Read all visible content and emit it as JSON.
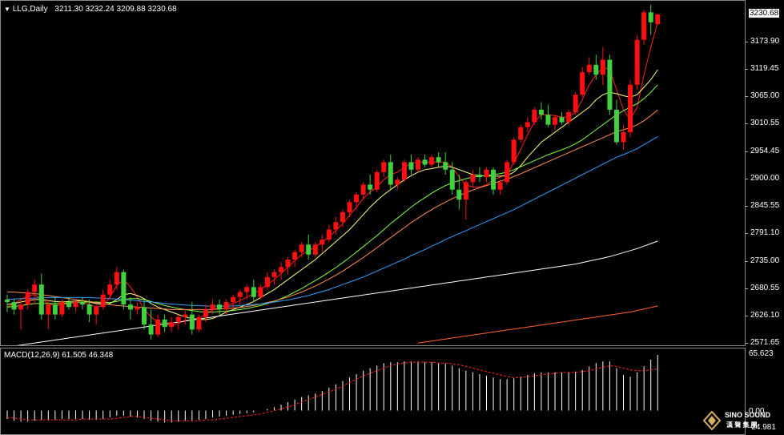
{
  "header": {
    "symbol_label": "LLG,Daily",
    "ohlc": "3211.30 3232.24 3209.88 3230.68",
    "menu_icon": "triangle-down-icon"
  },
  "price_axis": {
    "current": "3230.68",
    "ticks": [
      "3173.90",
      "3119.45",
      "3065.00",
      "3010.55",
      "2954.45",
      "2900.00",
      "2845.55",
      "2791.10",
      "2735.00",
      "2680.55",
      "2626.10",
      "2571.65"
    ]
  },
  "macd": {
    "label": "MACD(12,26,9) 61.505 46.348",
    "axis_top": "65.623",
    "axis_zero": "0.00",
    "axis_bottom": "-24.981"
  },
  "watermark": {
    "line1": "SINO SOUND",
    "line2": "漢 聲 集 團"
  },
  "colors": {
    "up": "#ff1010",
    "down": "#40d040",
    "ma5": "#ff2020",
    "ma10": "#ffff80",
    "ma20": "#80ff40",
    "ma30": "#ff9050",
    "ma60": "#30a0ff",
    "ma120": "#ffffff",
    "ma250": "#ff6030",
    "macd_bars": "#ffffff",
    "signal": "#ff2020"
  },
  "chart_data": {
    "type": "candlestick",
    "ylim": [
      2571.65,
      3250
    ],
    "candles": [
      [
        2660,
        2670,
        2635,
        2655
      ],
      [
        2655,
        2662,
        2630,
        2640
      ],
      [
        2640,
        2660,
        2600,
        2650
      ],
      [
        2650,
        2680,
        2640,
        2675
      ],
      [
        2675,
        2700,
        2650,
        2690
      ],
      [
        2690,
        2712,
        2620,
        2630
      ],
      [
        2630,
        2660,
        2600,
        2650
      ],
      [
        2650,
        2665,
        2620,
        2630
      ],
      [
        2630,
        2660,
        2625,
        2655
      ],
      [
        2655,
        2665,
        2640,
        2645
      ],
      [
        2645,
        2660,
        2635,
        2655
      ],
      [
        2655,
        2665,
        2640,
        2650
      ],
      [
        2650,
        2660,
        2615,
        2630
      ],
      [
        2630,
        2650,
        2610,
        2645
      ],
      [
        2645,
        2680,
        2640,
        2670
      ],
      [
        2670,
        2700,
        2660,
        2690
      ],
      [
        2690,
        2725,
        2680,
        2715
      ],
      [
        2715,
        2720,
        2640,
        2650
      ],
      [
        2650,
        2665,
        2620,
        2640
      ],
      [
        2640,
        2655,
        2630,
        2645
      ],
      [
        2645,
        2660,
        2600,
        2610
      ],
      [
        2610,
        2640,
        2580,
        2590
      ],
      [
        2590,
        2630,
        2585,
        2620
      ],
      [
        2620,
        2630,
        2595,
        2605
      ],
      [
        2605,
        2625,
        2595,
        2615
      ],
      [
        2615,
        2630,
        2600,
        2625
      ],
      [
        2625,
        2640,
        2610,
        2630
      ],
      [
        2630,
        2655,
        2590,
        2600
      ],
      [
        2600,
        2630,
        2595,
        2625
      ],
      [
        2625,
        2650,
        2615,
        2640
      ],
      [
        2640,
        2660,
        2630,
        2650
      ],
      [
        2650,
        2660,
        2630,
        2640
      ],
      [
        2640,
        2660,
        2630,
        2655
      ],
      [
        2655,
        2670,
        2640,
        2665
      ],
      [
        2665,
        2680,
        2650,
        2675
      ],
      [
        2675,
        2690,
        2660,
        2685
      ],
      [
        2685,
        2700,
        2655,
        2665
      ],
      [
        2665,
        2690,
        2660,
        2685
      ],
      [
        2685,
        2715,
        2680,
        2705
      ],
      [
        2705,
        2720,
        2690,
        2715
      ],
      [
        2715,
        2735,
        2700,
        2725
      ],
      [
        2725,
        2745,
        2710,
        2740
      ],
      [
        2740,
        2760,
        2725,
        2755
      ],
      [
        2755,
        2775,
        2745,
        2770
      ],
      [
        2770,
        2790,
        2740,
        2750
      ],
      [
        2750,
        2775,
        2745,
        2770
      ],
      [
        2770,
        2790,
        2755,
        2780
      ],
      [
        2780,
        2810,
        2775,
        2800
      ],
      [
        2800,
        2825,
        2790,
        2815
      ],
      [
        2815,
        2840,
        2805,
        2835
      ],
      [
        2835,
        2860,
        2825,
        2855
      ],
      [
        2855,
        2875,
        2840,
        2870
      ],
      [
        2870,
        2895,
        2860,
        2890
      ],
      [
        2890,
        2910,
        2870,
        2880
      ],
      [
        2880,
        2920,
        2875,
        2915
      ],
      [
        2915,
        2940,
        2905,
        2935
      ],
      [
        2935,
        2950,
        2880,
        2890
      ],
      [
        2890,
        2905,
        2880,
        2900
      ],
      [
        2900,
        2940,
        2895,
        2935
      ],
      [
        2935,
        2950,
        2910,
        2920
      ],
      [
        2920,
        2945,
        2915,
        2940
      ],
      [
        2940,
        2950,
        2925,
        2930
      ],
      [
        2930,
        2950,
        2925,
        2945
      ],
      [
        2945,
        2955,
        2925,
        2935
      ],
      [
        2935,
        2955,
        2910,
        2920
      ],
      [
        2920,
        2935,
        2870,
        2880
      ],
      [
        2880,
        2910,
        2840,
        2860
      ],
      [
        2860,
        2900,
        2820,
        2895
      ],
      [
        2895,
        2920,
        2885,
        2910
      ],
      [
        2910,
        2925,
        2895,
        2905
      ],
      [
        2905,
        2925,
        2895,
        2920
      ],
      [
        2920,
        2925,
        2870,
        2880
      ],
      [
        2880,
        2900,
        2870,
        2895
      ],
      [
        2895,
        2940,
        2890,
        2935
      ],
      [
        2935,
        2985,
        2930,
        2980
      ],
      [
        2980,
        3010,
        2975,
        3005
      ],
      [
        3005,
        3025,
        2995,
        3015
      ],
      [
        3015,
        3045,
        3010,
        3040
      ],
      [
        3040,
        3055,
        3020,
        3030
      ],
      [
        3030,
        3050,
        3005,
        3010
      ],
      [
        3010,
        3030,
        3000,
        3025
      ],
      [
        3025,
        3035,
        3010,
        3015
      ],
      [
        3015,
        3040,
        3010,
        3035
      ],
      [
        3035,
        3075,
        3030,
        3070
      ],
      [
        3070,
        3125,
        3065,
        3115
      ],
      [
        3115,
        3145,
        3110,
        3130
      ],
      [
        3130,
        3150,
        3100,
        3110
      ],
      [
        3110,
        3165,
        3090,
        3140
      ],
      [
        3140,
        3150,
        3030,
        3040
      ],
      [
        3040,
        3060,
        2970,
        2975
      ],
      [
        2975,
        3010,
        2960,
        2995
      ],
      [
        2995,
        3100,
        2985,
        3090
      ],
      [
        3090,
        3190,
        3080,
        3180
      ],
      [
        3180,
        3240,
        3170,
        3235
      ],
      [
        3235,
        3250,
        3190,
        3215
      ],
      [
        3211.3,
        3232.24,
        3209.88,
        3230.68
      ]
    ],
    "ma_values": {
      "ma5": [
        2645,
        2652,
        2660,
        2668,
        2670,
        2660,
        2652,
        2648,
        2650,
        2652,
        2655,
        2655,
        2650,
        2645,
        2648,
        2665,
        2688,
        2700,
        2685,
        2665,
        2640,
        2625,
        2615,
        2610,
        2608,
        2612,
        2618,
        2620,
        2622,
        2630,
        2640,
        2645,
        2648,
        2652,
        2658,
        2665,
        2672,
        2680,
        2690,
        2700,
        2712,
        2725,
        2738,
        2750,
        2758,
        2765,
        2775,
        2785,
        2798,
        2812,
        2828,
        2845,
        2862,
        2875,
        2885,
        2900,
        2910,
        2915,
        2925,
        2932,
        2935,
        2935,
        2935,
        2935,
        2935,
        2925,
        2905,
        2890,
        2885,
        2885,
        2890,
        2900,
        2905,
        2910,
        2935,
        2960,
        2990,
        3015,
        3030,
        3030,
        3028,
        3025,
        3025,
        3035,
        3060,
        3090,
        3110,
        3125,
        3120,
        3080,
        3040,
        3020,
        3045,
        3110,
        3165,
        3215
      ],
      "ma10": [
        2650,
        2652,
        2655,
        2658,
        2660,
        2660,
        2658,
        2656,
        2655,
        2656,
        2657,
        2658,
        2655,
        2652,
        2650,
        2652,
        2660,
        2670,
        2672,
        2668,
        2662,
        2652,
        2645,
        2640,
        2635,
        2630,
        2625,
        2622,
        2620,
        2620,
        2622,
        2628,
        2635,
        2640,
        2645,
        2650,
        2656,
        2664,
        2672,
        2680,
        2690,
        2700,
        2710,
        2720,
        2730,
        2740,
        2752,
        2764,
        2776,
        2788,
        2800,
        2815,
        2830,
        2845,
        2858,
        2870,
        2880,
        2890,
        2900,
        2908,
        2915,
        2920,
        2922,
        2925,
        2927,
        2925,
        2920,
        2915,
        2910,
        2908,
        2907,
        2907,
        2907,
        2908,
        2915,
        2928,
        2945,
        2960,
        2975,
        2985,
        2995,
        3005,
        3015,
        3025,
        3035,
        3045,
        3060,
        3070,
        3075,
        3072,
        3068,
        3065,
        3070,
        3085,
        3100,
        3120
      ],
      "ma20": [
        2645,
        2646,
        2648,
        2650,
        2652,
        2652,
        2652,
        2652,
        2652,
        2653,
        2654,
        2655,
        2655,
        2655,
        2654,
        2654,
        2656,
        2660,
        2662,
        2662,
        2660,
        2656,
        2652,
        2648,
        2645,
        2642,
        2640,
        2638,
        2636,
        2635,
        2635,
        2636,
        2637,
        2638,
        2640,
        2642,
        2645,
        2648,
        2652,
        2656,
        2662,
        2668,
        2675,
        2682,
        2690,
        2698,
        2706,
        2715,
        2724,
        2734,
        2744,
        2755,
        2766,
        2777,
        2788,
        2800,
        2812,
        2823,
        2834,
        2845,
        2855,
        2864,
        2873,
        2881,
        2888,
        2894,
        2898,
        2902,
        2905,
        2907,
        2908,
        2910,
        2912,
        2915,
        2920,
        2926,
        2932,
        2938,
        2944,
        2950,
        2955,
        2960,
        2965,
        2972,
        2980,
        2990,
        3000,
        3010,
        3020,
        3030,
        3038,
        3045,
        3052,
        3062,
        3075,
        3090
      ],
      "ma30": [
        2675,
        2675,
        2674,
        2673,
        2672,
        2670,
        2668,
        2666,
        2664,
        2662,
        2660,
        2658,
        2656,
        2654,
        2652,
        2650,
        2648,
        2647,
        2646,
        2645,
        2644,
        2643,
        2642,
        2641,
        2640,
        2640,
        2640,
        2640,
        2640,
        2640,
        2640,
        2641,
        2642,
        2643,
        2644,
        2646,
        2648,
        2651,
        2654,
        2657,
        2661,
        2665,
        2670,
        2675,
        2681,
        2687,
        2694,
        2701,
        2709,
        2717,
        2726,
        2735,
        2744,
        2754,
        2764,
        2774,
        2784,
        2794,
        2804,
        2814,
        2823,
        2832,
        2840,
        2848,
        2855,
        2862,
        2868,
        2874,
        2879,
        2884,
        2888,
        2893,
        2897,
        2901,
        2906,
        2912,
        2918,
        2924,
        2930,
        2936,
        2942,
        2948,
        2954,
        2960,
        2966,
        2972,
        2978,
        2984,
        2990,
        2996,
        3000,
        3004,
        3010,
        3018,
        3028,
        3040
      ],
      "ma60": [
        2660,
        2661,
        2662,
        2662,
        2663,
        2663,
        2664,
        2664,
        2664,
        2664,
        2664,
        2664,
        2664,
        2663,
        2663,
        2662,
        2661,
        2660,
        2659,
        2658,
        2656,
        2655,
        2654,
        2652,
        2651,
        2650,
        2649,
        2648,
        2648,
        2647,
        2647,
        2647,
        2647,
        2647,
        2648,
        2649,
        2650,
        2651,
        2653,
        2655,
        2657,
        2659,
        2662,
        2665,
        2668,
        2672,
        2676,
        2680,
        2685,
        2690,
        2695,
        2700,
        2705,
        2711,
        2717,
        2723,
        2729,
        2735,
        2741,
        2748,
        2754,
        2760,
        2767,
        2773,
        2780,
        2786,
        2792,
        2798,
        2804,
        2810,
        2816,
        2822,
        2828,
        2834,
        2840,
        2847,
        2854,
        2861,
        2868,
        2875,
        2882,
        2889,
        2896,
        2903,
        2910,
        2917,
        2924,
        2931,
        2938,
        2945,
        2950,
        2956,
        2962,
        2970,
        2978,
        2986
      ],
      "ma120": [
        2565,
        2567,
        2569,
        2571,
        2573,
        2575,
        2577,
        2579,
        2581,
        2583,
        2585,
        2587,
        2589,
        2591,
        2593,
        2595,
        2597,
        2599,
        2601,
        2603,
        2605,
        2607,
        2609,
        2611,
        2613,
        2615,
        2617,
        2619,
        2621,
        2623,
        2625,
        2627,
        2629,
        2631,
        2633,
        2635,
        2637,
        2639,
        2641,
        2643,
        2645,
        2647,
        2649,
        2651,
        2653,
        2655,
        2657,
        2659,
        2661,
        2663,
        2665,
        2667,
        2669,
        2671,
        2673,
        2675,
        2677,
        2679,
        2681,
        2683,
        2685,
        2687,
        2689,
        2691,
        2693,
        2695,
        2697,
        2699,
        2701,
        2703,
        2705,
        2707,
        2709,
        2711,
        2713,
        2715,
        2717,
        2719,
        2721,
        2723,
        2725,
        2727,
        2729,
        2731,
        2734,
        2737,
        2740,
        2743,
        2746,
        2750,
        2754,
        2758,
        2762,
        2767,
        2772,
        2777
      ],
      "ma250": [
        null,
        null,
        null,
        null,
        null,
        null,
        null,
        null,
        null,
        null,
        null,
        null,
        null,
        null,
        null,
        null,
        null,
        null,
        null,
        null,
        null,
        null,
        null,
        null,
        null,
        null,
        null,
        null,
        null,
        null,
        null,
        null,
        null,
        null,
        null,
        null,
        null,
        null,
        null,
        null,
        null,
        null,
        null,
        null,
        null,
        null,
        null,
        null,
        null,
        null,
        null,
        null,
        null,
        null,
        null,
        null,
        null,
        null,
        null,
        null,
        2573,
        2575,
        2577,
        2579,
        2581,
        2583,
        2585,
        2587,
        2589,
        2591,
        2593,
        2595,
        2597,
        2599,
        2601,
        2603,
        2605,
        2607,
        2609,
        2611,
        2613,
        2615,
        2617,
        2619,
        2621,
        2623,
        2625,
        2627,
        2629,
        2631,
        2633,
        2635,
        2638,
        2641,
        2644,
        2647
      ]
    },
    "macd_hist": [
      -10,
      -12,
      -13,
      -13,
      -12,
      -11,
      -11,
      -11,
      -10,
      -10,
      -10,
      -10,
      -11,
      -11,
      -10,
      -8,
      -6,
      -6,
      -7,
      -8,
      -10,
      -12,
      -13,
      -14,
      -14,
      -13,
      -12,
      -12,
      -11,
      -10,
      -8,
      -7,
      -6,
      -5,
      -4,
      -3,
      -2,
      0,
      2,
      4,
      7,
      10,
      13,
      16,
      18,
      20,
      23,
      27,
      31,
      35,
      39,
      43,
      47,
      50,
      53,
      56,
      57,
      57,
      58,
      58,
      58,
      57,
      57,
      56,
      55,
      53,
      50,
      47,
      45,
      43,
      41,
      39,
      37,
      37,
      38,
      40,
      42,
      44,
      45,
      45,
      45,
      45,
      45,
      46,
      48,
      52,
      56,
      58,
      58,
      50,
      42,
      40,
      45,
      52,
      60,
      65.623
    ],
    "macd_signal": [
      -8,
      -9,
      -10,
      -11,
      -11,
      -11,
      -11,
      -11,
      -11,
      -11,
      -11,
      -10,
      -10,
      -10,
      -10,
      -10,
      -9,
      -8,
      -7,
      -7,
      -8,
      -9,
      -10,
      -11,
      -12,
      -12,
      -12,
      -12,
      -12,
      -11,
      -11,
      -10,
      -9,
      -8,
      -7,
      -6,
      -5,
      -4,
      -2,
      0,
      2,
      4,
      7,
      10,
      13,
      16,
      19,
      22,
      25,
      29,
      33,
      37,
      41,
      44,
      47,
      50,
      53,
      55,
      56,
      57,
      57,
      57,
      57,
      56,
      56,
      55,
      54,
      52,
      50,
      48,
      46,
      44,
      42,
      40,
      39,
      39,
      40,
      41,
      42,
      43,
      44,
      45,
      45,
      45,
      46,
      47,
      49,
      51,
      53,
      52,
      50,
      48,
      47,
      47,
      48,
      49
    ]
  }
}
